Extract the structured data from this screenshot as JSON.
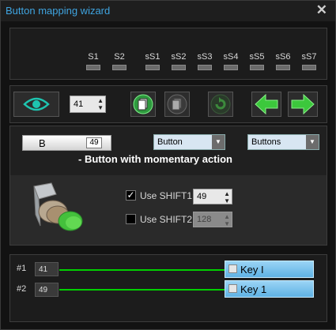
{
  "window": {
    "title": "Button mapping wizard",
    "close": "✕"
  },
  "shifts": [
    "S1",
    "S2",
    "sS1",
    "sS2",
    "sS3",
    "sS4",
    "sS5",
    "sS6",
    "sS7"
  ],
  "toolbar": {
    "value": "41"
  },
  "button": {
    "letter": "B",
    "number": "49",
    "type_select": "Button",
    "category_select": "Buttons",
    "description": "- Button with momentary action"
  },
  "shift_opts": [
    {
      "label": "Use SHIFT1",
      "checked": true,
      "value": "49"
    },
    {
      "label": "Use SHIFT2",
      "checked": false,
      "value": "128"
    }
  ],
  "mappings": [
    {
      "row": "#1",
      "num": "41",
      "key": "Key I"
    },
    {
      "row": "#2",
      "num": "49",
      "key": "Key 1"
    }
  ],
  "check_mark": "✓",
  "colors": {
    "accent": "#3fa4e0",
    "link_line": "#00d000",
    "key_fill": "#7cc3ee"
  }
}
